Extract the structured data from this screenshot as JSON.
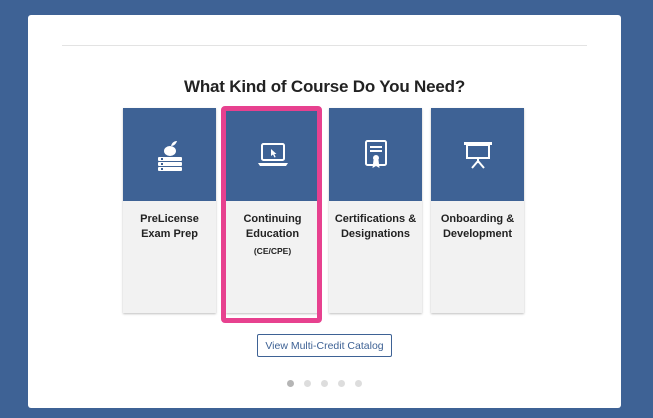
{
  "heading": "What Kind of Course Do You Need?",
  "cards": [
    {
      "label": "PreLicense Exam Prep",
      "sub": "",
      "icon": "apple-books-icon"
    },
    {
      "label": "Continuing Education",
      "sub": "(CE/CPE)",
      "icon": "laptop-cursor-icon"
    },
    {
      "label": "Certifications & Designations",
      "sub": "",
      "icon": "certificate-icon"
    },
    {
      "label": "Onboarding & Development",
      "sub": "",
      "icon": "presentation-board-icon"
    }
  ],
  "catalog_button": "View Multi-Credit Catalog",
  "carousel": {
    "total": 5,
    "active": 1
  },
  "colors": {
    "brand": "#3e6295",
    "highlight": "#e7418f",
    "card_bg": "#f2f2f2"
  }
}
